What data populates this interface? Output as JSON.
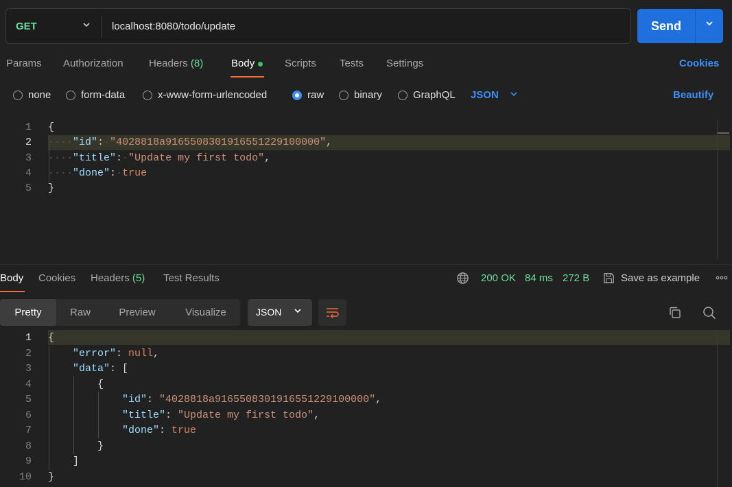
{
  "request": {
    "method": "GET",
    "url": "localhost:8080/todo/update",
    "send_label": "Send"
  },
  "request_tabs": {
    "params": "Params",
    "authorization": "Authorization",
    "headers": "Headers",
    "headers_count": "(8)",
    "body": "Body",
    "scripts": "Scripts",
    "tests": "Tests",
    "settings": "Settings",
    "cookies": "Cookies"
  },
  "body_types": {
    "none": "none",
    "form_data": "form-data",
    "urlencoded": "x-www-form-urlencoded",
    "raw": "raw",
    "binary": "binary",
    "graphql": "GraphQL",
    "language": "JSON",
    "beautify": "Beautify"
  },
  "request_body": {
    "line_numbers": [
      "1",
      "2",
      "3",
      "4",
      "5"
    ],
    "open_brace": "{",
    "close_brace": "}",
    "id_key": "\"id\"",
    "id_value": "\"4028818a9165508301916551229100000\"",
    "title_key": "\"title\"",
    "title_value": "\"Update my first todo\"",
    "done_key": "\"done\"",
    "done_value": "true"
  },
  "response_tabs": {
    "body": "Body",
    "cookies": "Cookies",
    "headers": "Headers",
    "headers_count": "(5)",
    "test_results": "Test Results"
  },
  "response_status": {
    "status": "200 OK",
    "time": "84 ms",
    "size": "272 B",
    "save_example": "Save as example"
  },
  "response_view": {
    "pretty": "Pretty",
    "raw": "Raw",
    "preview": "Preview",
    "visualize": "Visualize",
    "format": "JSON"
  },
  "response_body": {
    "line_numbers": [
      "1",
      "2",
      "3",
      "4",
      "5",
      "6",
      "7",
      "8",
      "9",
      "10"
    ],
    "open_brace": "{",
    "close_brace": "}",
    "error_key": "\"error\"",
    "error_value": "null",
    "data_key": "\"data\"",
    "open_bracket": "[",
    "close_bracket": "]",
    "item_open": "{",
    "item_close": "}",
    "id_key": "\"id\"",
    "id_value": "\"4028818a9165508301916551229100000\"",
    "title_key": "\"title\"",
    "title_value": "\"Update my first todo\"",
    "done_key": "\"done\"",
    "done_value": "true"
  },
  "colors": {
    "accent": "#1f6fde",
    "active_tab_underline": "#f26b3a",
    "status_green": "#6bdd9a",
    "link_blue": "#3b8ff6"
  }
}
